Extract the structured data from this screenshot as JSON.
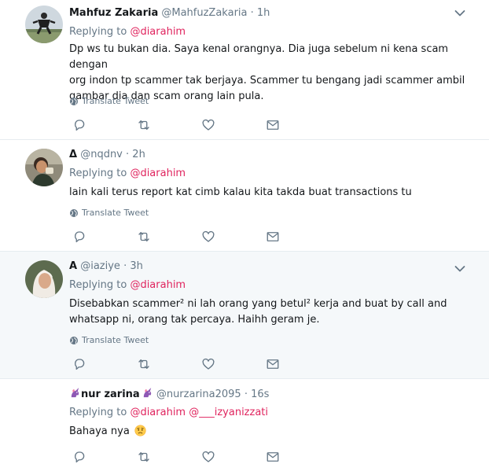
{
  "tweets": [
    {
      "name": "Mahfuz Zakaria",
      "handle": "@MahfuzZakaria",
      "time": "· 1h",
      "replying_prefix": "Replying to",
      "replying_to": "@diarahim",
      "text_lines": [
        "Dp ws tu bukan dia. Saya kenal orangnya. Dia juga sebelum ni kena scam dengan",
        "org indon tp scammer tak berjaya. Scammer tu bengang jadi scammer ambil",
        "gambar dia dan scam orang lain pula."
      ],
      "translate": "Translate Tweet"
    },
    {
      "name": "Δ",
      "handle": "@nqdnv",
      "time": "· 2h",
      "replying_prefix": "Replying to",
      "replying_to": "@diarahim",
      "text_lines": [
        "lain kali terus report kat cimb kalau kita takda buat transactions tu"
      ],
      "translate": "Translate Tweet"
    },
    {
      "name": "A",
      "handle": "@iaziye",
      "time": "· 3h",
      "replying_prefix": "Replying to",
      "replying_to": "@diarahim",
      "text_lines": [
        "Disebabkan scammer² ni lah orang yang betul² kerja and buat by call and",
        "whatsapp ni, orang tak percaya. Haihh geram je."
      ],
      "translate": "Translate Tweet"
    },
    {
      "name": "nur zarina",
      "handle": "@nurzarina2095",
      "time": "· 16s",
      "replying_prefix": "Replying to",
      "replying_to": "@diarahim",
      "replying_to_2": "@___izyanizzati",
      "text": "Bahaya nya"
    }
  ],
  "icons": {
    "reply": "reply-icon",
    "retweet": "retweet-icon",
    "like": "heart-icon",
    "dm": "envelope-icon",
    "more": "chevron-down-icon",
    "translate": "globe-icon",
    "name_decoration": "unicorn-icon",
    "emoji": "worried-face-emoji"
  },
  "colors": {
    "link": "#e0245e",
    "muted": "#657786",
    "highlight_bg": "#f5f8fa",
    "divider": "#e6ecf0"
  }
}
